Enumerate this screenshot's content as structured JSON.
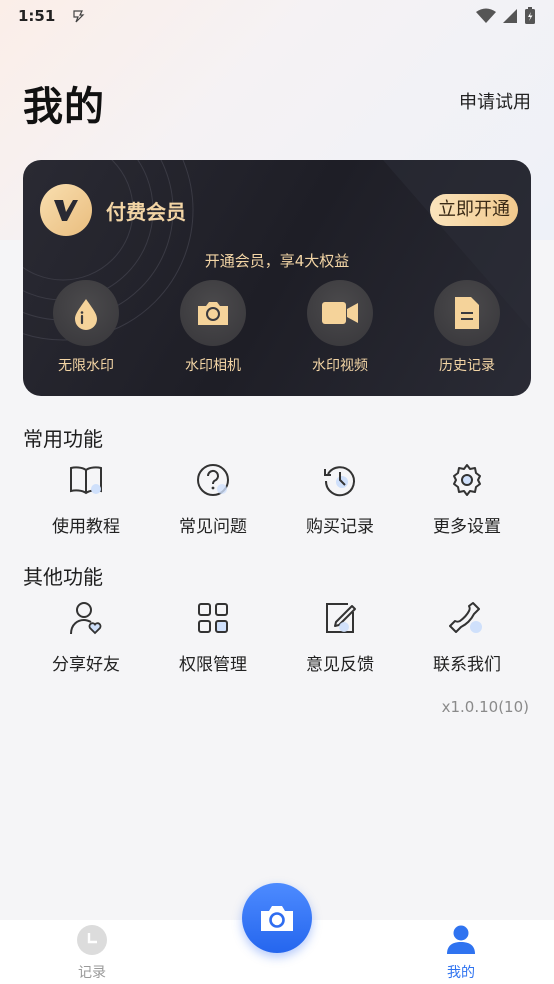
{
  "status_bar": {
    "time": "1:51"
  },
  "header": {
    "title": "我的",
    "trial_link": "申请试用"
  },
  "vip_card": {
    "title": "付费会员",
    "open_button": "立即开通",
    "subtitle": "开通会员，享4大权益",
    "perks": [
      {
        "label": "无限水印",
        "icon": "water-drop-icon"
      },
      {
        "label": "水印相机",
        "icon": "camera-icon"
      },
      {
        "label": "水印视频",
        "icon": "video-camera-icon"
      },
      {
        "label": "历史记录",
        "icon": "document-icon"
      }
    ],
    "colors": {
      "gold": "#f3d5a5",
      "card_bg": "#23232b"
    }
  },
  "common_functions": {
    "title": "常用功能",
    "items": [
      {
        "label": "使用教程",
        "icon": "book-icon"
      },
      {
        "label": "常见问题",
        "icon": "question-circle-icon"
      },
      {
        "label": "购买记录",
        "icon": "history-clock-icon"
      },
      {
        "label": "更多设置",
        "icon": "gear-icon"
      }
    ]
  },
  "other_functions": {
    "title": "其他功能",
    "items": [
      {
        "label": "分享好友",
        "icon": "user-heart-icon"
      },
      {
        "label": "权限管理",
        "icon": "grid-icon"
      },
      {
        "label": "意见反馈",
        "icon": "edit-icon"
      },
      {
        "label": "联系我们",
        "icon": "phone-icon"
      }
    ]
  },
  "version": "x1.0.10(10)",
  "tab_bar": {
    "record_label": "记录",
    "mine_label": "我的",
    "active_color": "#2f73f0",
    "inactive_color": "#9a9a9a"
  }
}
